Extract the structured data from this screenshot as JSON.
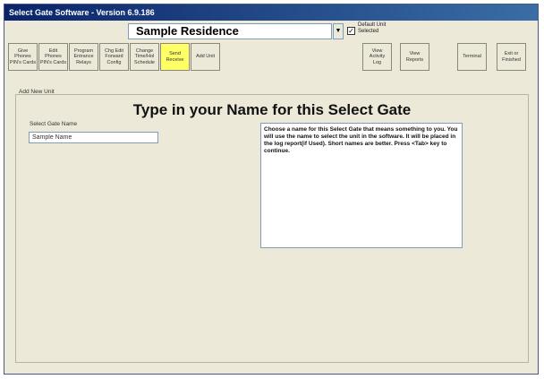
{
  "window": {
    "title": "Select Gate Software - Version 6.9.186"
  },
  "toolbar": {
    "residence": "Sample Residence",
    "default_unit_label": "Default Unit\nSelected",
    "default_unit_checked": true,
    "buttons": [
      {
        "label": "Give\nPhones\nPIN's Cards"
      },
      {
        "label": "Edit\nPhones\nPIN's Cards"
      },
      {
        "label": "Program\nEntrance\nRelays"
      },
      {
        "label": "Chg Edit\nForward\nConfig"
      },
      {
        "label": "Change\nTime/Hol\nSchedule"
      },
      {
        "label": "Send\nReceive",
        "highlight": "#ffff66"
      },
      {
        "label": "Add Unit"
      },
      {
        "label": "View\nActivity\nLog"
      },
      {
        "label": "View\nReports"
      },
      {
        "label": "Terminal"
      },
      {
        "label": "Exit or\nFinished"
      }
    ]
  },
  "main": {
    "group_label": "Add New Unit",
    "heading": "Type in your Name for this Select Gate",
    "field_label": "Select Gate Name",
    "field_value": "Sample Name",
    "help_text": "Choose a name for this Select Gate that means something to you. You will use the name to select the unit in the software. It will be placed in the log report(if Used). Short names are better. Press <Tab> key to continue."
  }
}
